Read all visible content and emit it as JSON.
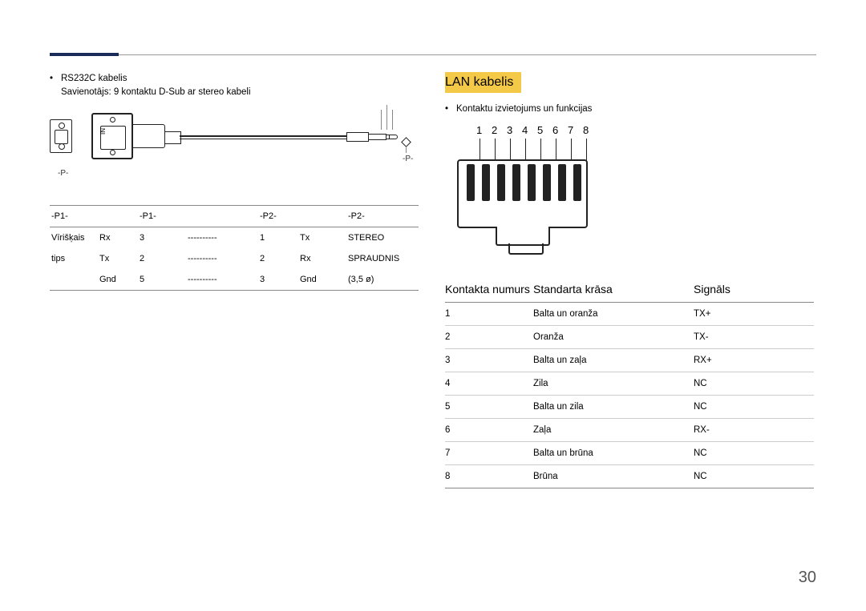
{
  "left": {
    "bullet1": "RS232C kabelis",
    "sub1": "Savienotājs: 9 kontaktu D-Sub ar stereo kabeli",
    "diagram": {
      "in_label": "IN",
      "p_left": "-P-",
      "p_right": "-P-"
    },
    "pinout": {
      "headers": [
        "-P1-",
        "-P1-",
        "",
        "-P2-",
        "",
        "-P2-"
      ],
      "rows": [
        [
          "Vīrišķais",
          "Rx",
          "3",
          "----------",
          "1",
          "Tx",
          "STEREO"
        ],
        [
          "tips",
          "Tx",
          "2",
          "----------",
          "2",
          "Rx",
          "SPRAUDNIS"
        ],
        [
          "",
          "Gnd",
          "5",
          "----------",
          "3",
          "Gnd",
          "(3,5 ø)"
        ]
      ]
    }
  },
  "right": {
    "title": "LAN kabelis",
    "bullet1": "Kontaktu izvietojums un funkcijas",
    "rj45_pins": [
      "1",
      "2",
      "3",
      "4",
      "5",
      "6",
      "7",
      "8"
    ],
    "table": {
      "headers": [
        "Kontakta numurs",
        "Standarta krāsa",
        "Signāls"
      ],
      "rows": [
        [
          "1",
          "Balta un oranža",
          "TX+"
        ],
        [
          "2",
          "Oranža",
          "TX-"
        ],
        [
          "3",
          "Balta un zaļa",
          "RX+"
        ],
        [
          "4",
          "Zila",
          "NC"
        ],
        [
          "5",
          "Balta un zila",
          "NC"
        ],
        [
          "6",
          "Zaļa",
          "RX-"
        ],
        [
          "7",
          "Balta un brūna",
          "NC"
        ],
        [
          "8",
          "Brūna",
          "NC"
        ]
      ]
    }
  },
  "page_number": "30"
}
